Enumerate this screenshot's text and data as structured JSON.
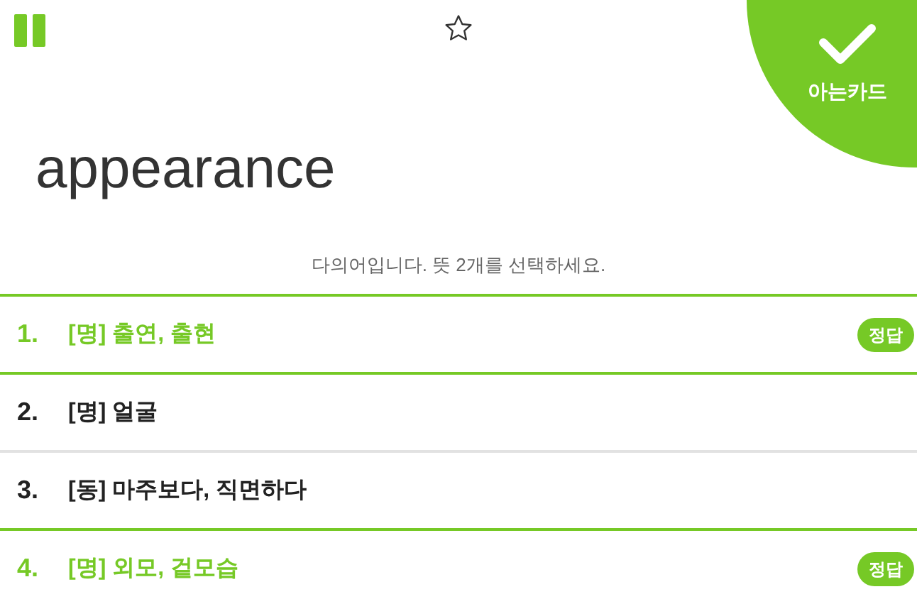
{
  "toolbar": {
    "starred": false
  },
  "known_card_button": {
    "label": "아는카드"
  },
  "word": "appearance",
  "instruction": "다의어입니다. 뜻 2개를 선택하세요.",
  "options": [
    {
      "number": "1.",
      "text": "[명] 출연, 출현",
      "correct": true,
      "badge": "정답"
    },
    {
      "number": "2.",
      "text": "[명] 얼굴",
      "correct": false
    },
    {
      "number": "3.",
      "text": "[동] 마주보다, 직면하다",
      "correct": false
    },
    {
      "number": "4.",
      "text": "[명] 외모, 겉모습",
      "correct": true,
      "badge": "정답"
    }
  ]
}
